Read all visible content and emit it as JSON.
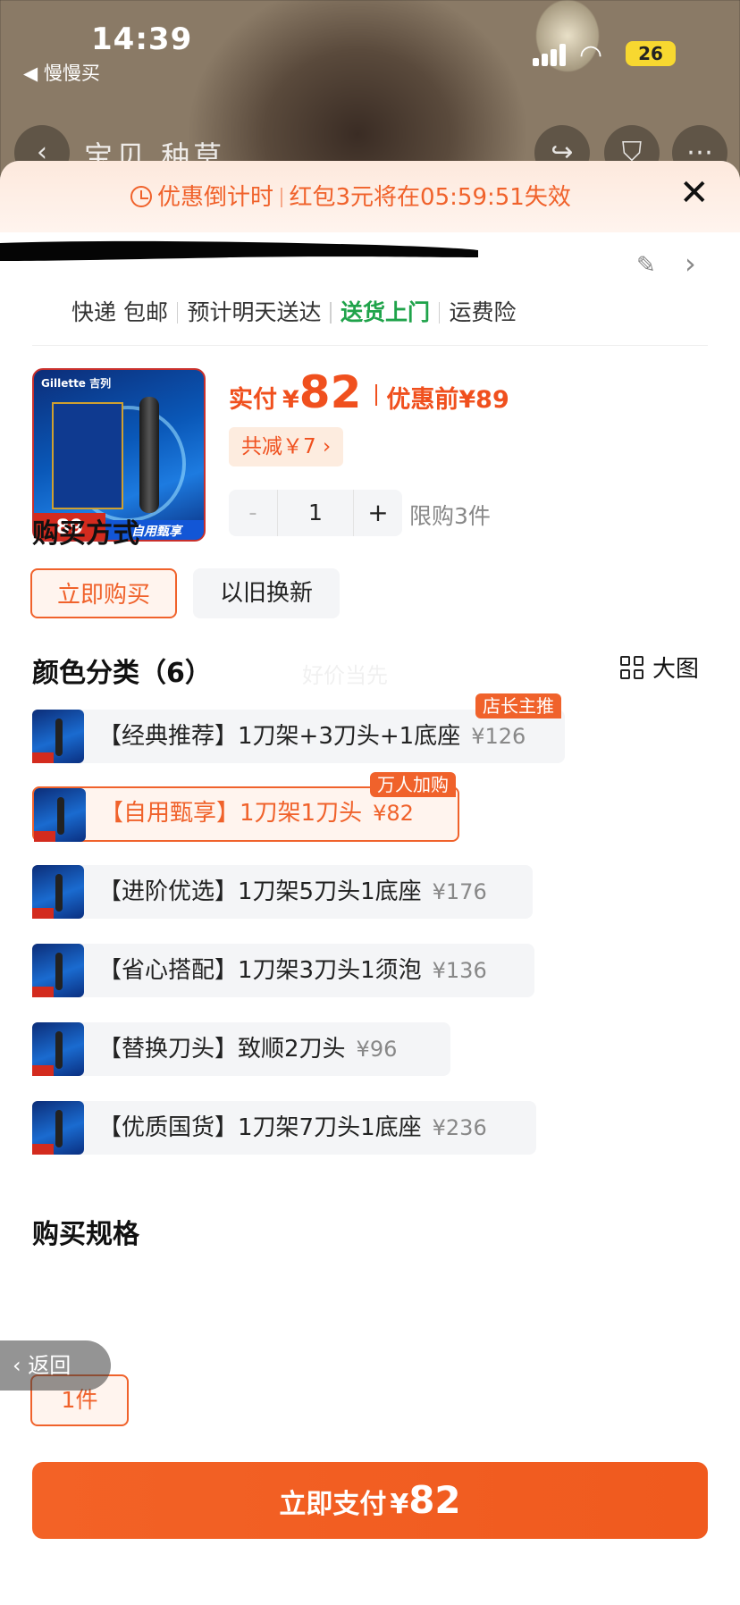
{
  "status_bar": {
    "time": "14:39",
    "back_app": "◀ 慢慢买",
    "battery": "26"
  },
  "top_nav": {
    "title": "宝贝 种草"
  },
  "countdown": {
    "label": "优惠倒计时",
    "message": "红包3元将在05:59:51失效"
  },
  "delivery": {
    "express": "快递 包邮",
    "eta": "预计明天送达",
    "door": "送货上门",
    "insurance": "运费险"
  },
  "product": {
    "image_brand": "Gillette 吉列",
    "image_price": "89",
    "image_band": "自用甄享",
    "price_label": "实付",
    "currency": "¥",
    "price": "82",
    "before_label": "优惠前¥89",
    "discount_chip": "共减￥7 ›",
    "quantity": "1",
    "minus": "-",
    "plus": "+",
    "limit": "限购3件"
  },
  "purchase_method": {
    "title": "购买方式",
    "options": [
      "立即购买",
      "以旧换新"
    ],
    "selected": 0
  },
  "colors": {
    "title": "颜色分类（6）",
    "big_view": "大图",
    "watermark": "好价当先",
    "variants": [
      {
        "name": "【经典推荐】1刀架+3刀头+1底座",
        "price": "¥126",
        "badge": "店长主推"
      },
      {
        "name": "【自用甄享】1刀架1刀头",
        "price": "¥82",
        "badge": "万人加购",
        "selected": true
      },
      {
        "name": "【进阶优选】1刀架5刀头1底座",
        "price": "¥176"
      },
      {
        "name": "【省心搭配】1刀架3刀头1须泡",
        "price": "¥136"
      },
      {
        "name": "【替换刀头】致顺2刀头",
        "price": "¥96"
      },
      {
        "name": "【优质国货】1刀架7刀头1底座",
        "price": "¥236"
      }
    ]
  },
  "spec": {
    "title": "购买规格",
    "option": "1件"
  },
  "back_pill": "返回",
  "pay": {
    "label": "立即支付",
    "currency": "¥",
    "amount": "82"
  },
  "colors_theme": {
    "accent": "#f0622b",
    "green": "#1fa34a"
  }
}
